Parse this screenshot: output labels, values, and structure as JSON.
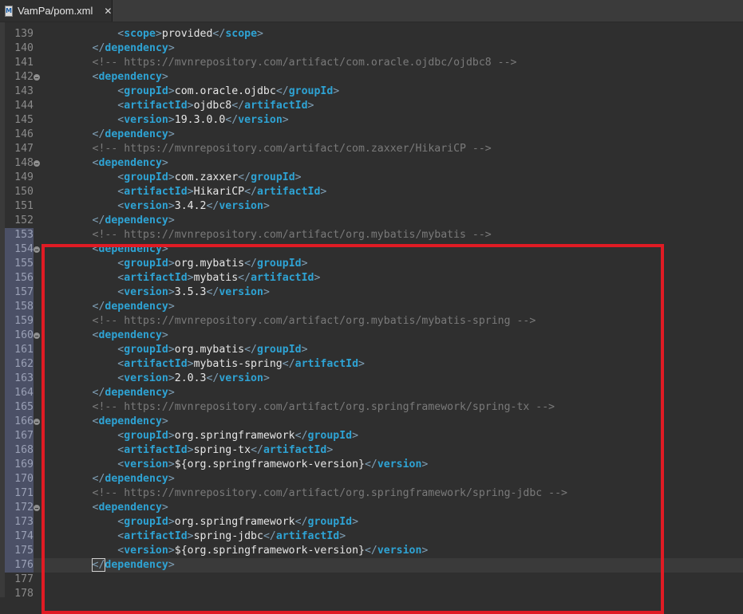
{
  "tab": {
    "title": "VamPa/pom.xml",
    "icon": "xml-file-icon",
    "icon_glyph": "M",
    "close_glyph": "✕"
  },
  "editor": {
    "lines": [
      {
        "num": "139",
        "indent": 3,
        "kind": "element",
        "tag": "scope",
        "text": "provided"
      },
      {
        "num": "140",
        "indent": 2,
        "kind": "close",
        "tag": "dependency"
      },
      {
        "num": "141",
        "indent": 2,
        "kind": "comment",
        "text": "<!-- https://mvnrepository.com/artifact/com.oracle.ojdbc/ojdbc8 -->"
      },
      {
        "num": "142",
        "indent": 2,
        "kind": "open",
        "tag": "dependency",
        "fold": true
      },
      {
        "num": "143",
        "indent": 3,
        "kind": "element",
        "tag": "groupId",
        "text": "com.oracle.ojdbc"
      },
      {
        "num": "144",
        "indent": 3,
        "kind": "element",
        "tag": "artifactId",
        "text": "ojdbc8"
      },
      {
        "num": "145",
        "indent": 3,
        "kind": "element",
        "tag": "version",
        "text": "19.3.0.0"
      },
      {
        "num": "146",
        "indent": 2,
        "kind": "close",
        "tag": "dependency"
      },
      {
        "num": "147",
        "indent": 2,
        "kind": "comment",
        "text": "<!-- https://mvnrepository.com/artifact/com.zaxxer/HikariCP -->"
      },
      {
        "num": "148",
        "indent": 2,
        "kind": "open",
        "tag": "dependency",
        "fold": true
      },
      {
        "num": "149",
        "indent": 3,
        "kind": "element",
        "tag": "groupId",
        "text": "com.zaxxer"
      },
      {
        "num": "150",
        "indent": 3,
        "kind": "element",
        "tag": "artifactId",
        "text": "HikariCP"
      },
      {
        "num": "151",
        "indent": 3,
        "kind": "element",
        "tag": "version",
        "text": "3.4.2"
      },
      {
        "num": "152",
        "indent": 2,
        "kind": "close",
        "tag": "dependency"
      },
      {
        "num": "153",
        "indent": 2,
        "kind": "comment",
        "text": "<!-- https://mvnrepository.com/artifact/org.mybatis/mybatis -->",
        "hl": true
      },
      {
        "num": "154",
        "indent": 2,
        "kind": "open",
        "tag": "dependency",
        "fold": true,
        "hl": true
      },
      {
        "num": "155",
        "indent": 3,
        "kind": "element",
        "tag": "groupId",
        "text": "org.mybatis",
        "hl": true
      },
      {
        "num": "156",
        "indent": 3,
        "kind": "element",
        "tag": "artifactId",
        "text": "mybatis",
        "hl": true
      },
      {
        "num": "157",
        "indent": 3,
        "kind": "element",
        "tag": "version",
        "text": "3.5.3",
        "hl": true
      },
      {
        "num": "158",
        "indent": 2,
        "kind": "close",
        "tag": "dependency",
        "hl": true
      },
      {
        "num": "159",
        "indent": 2,
        "kind": "comment",
        "text": "<!-- https://mvnrepository.com/artifact/org.mybatis/mybatis-spring -->",
        "hl": true
      },
      {
        "num": "160",
        "indent": 2,
        "kind": "open",
        "tag": "dependency",
        "fold": true,
        "hl": true
      },
      {
        "num": "161",
        "indent": 3,
        "kind": "element",
        "tag": "groupId",
        "text": "org.mybatis",
        "hl": true
      },
      {
        "num": "162",
        "indent": 3,
        "kind": "element",
        "tag": "artifactId",
        "text": "mybatis-spring",
        "hl": true
      },
      {
        "num": "163",
        "indent": 3,
        "kind": "element",
        "tag": "version",
        "text": "2.0.3",
        "hl": true
      },
      {
        "num": "164",
        "indent": 2,
        "kind": "close",
        "tag": "dependency",
        "hl": true
      },
      {
        "num": "165",
        "indent": 2,
        "kind": "comment",
        "text": "<!-- https://mvnrepository.com/artifact/org.springframework/spring-tx -->",
        "hl": true
      },
      {
        "num": "166",
        "indent": 2,
        "kind": "open",
        "tag": "dependency",
        "fold": true,
        "hl": true
      },
      {
        "num": "167",
        "indent": 3,
        "kind": "element",
        "tag": "groupId",
        "text": "org.springframework",
        "hl": true
      },
      {
        "num": "168",
        "indent": 3,
        "kind": "element",
        "tag": "artifactId",
        "text": "spring-tx",
        "hl": true
      },
      {
        "num": "169",
        "indent": 3,
        "kind": "element",
        "tag": "version",
        "text": "${org.springframework-version}",
        "hl": true
      },
      {
        "num": "170",
        "indent": 2,
        "kind": "close",
        "tag": "dependency",
        "hl": true
      },
      {
        "num": "171",
        "indent": 2,
        "kind": "comment",
        "text": "<!-- https://mvnrepository.com/artifact/org.springframework/spring-jdbc -->",
        "hl": true
      },
      {
        "num": "172",
        "indent": 2,
        "kind": "open",
        "tag": "dependency",
        "fold": true,
        "hl": true
      },
      {
        "num": "173",
        "indent": 3,
        "kind": "element",
        "tag": "groupId",
        "text": "org.springframework",
        "hl": true
      },
      {
        "num": "174",
        "indent": 3,
        "kind": "element",
        "tag": "artifactId",
        "text": "spring-jdbc",
        "hl": true
      },
      {
        "num": "175",
        "indent": 3,
        "kind": "element",
        "tag": "version",
        "text": "${org.springframework-version}",
        "hl": true
      },
      {
        "num": "176",
        "indent": 2,
        "kind": "close",
        "tag": "dependency",
        "hl": true,
        "current": true
      },
      {
        "num": "177",
        "indent": 0,
        "kind": "blank"
      },
      {
        "num": "178",
        "indent": 0,
        "kind": "blank"
      }
    ]
  },
  "colors": {
    "tag": "#2ea3d4",
    "bracket": "#7f9fb5",
    "comment": "#7a7a7a",
    "highlight_box": "#e01b24"
  }
}
